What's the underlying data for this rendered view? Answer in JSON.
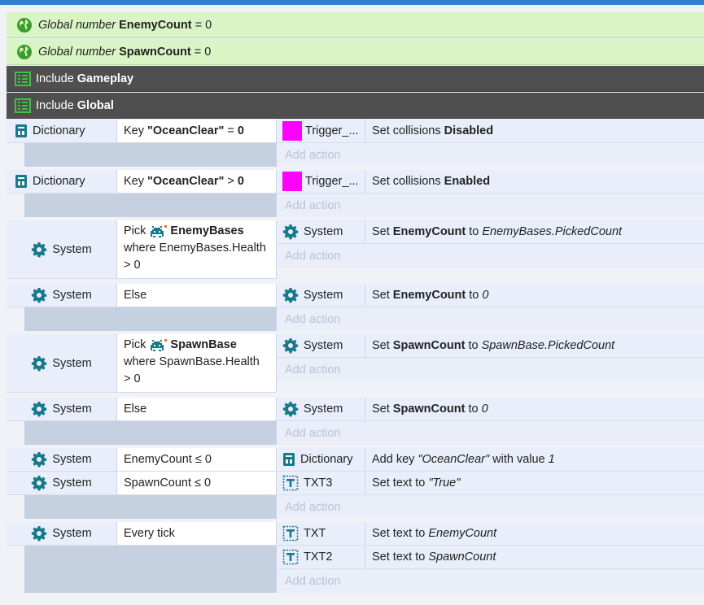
{
  "globals": [
    {
      "prefix": "Global number",
      "name": "EnemyCount",
      "suffix": "= 0"
    },
    {
      "prefix": "Global number",
      "name": "SpawnCount",
      "suffix": "= 0"
    }
  ],
  "includes": [
    {
      "prefix": "Include",
      "name": "Gameplay"
    },
    {
      "prefix": "Include",
      "name": "Global"
    }
  ],
  "add_action_label": "Add action",
  "events": {
    "e1": {
      "cond_obj": "Dictionary",
      "cond_a": "Key",
      "cond_b": "\"OceanClear\"",
      "cond_c": "=",
      "cond_d": "0",
      "act_obj": "Trigger_...",
      "act_a": "Set collisions",
      "act_b": "Disabled"
    },
    "e2": {
      "cond_obj": "Dictionary",
      "cond_a": "Key",
      "cond_b": "\"OceanClear\"",
      "cond_c": ">",
      "cond_d": "0",
      "act_obj": "Trigger_...",
      "act_a": "Set collisions",
      "act_b": "Enabled"
    },
    "e3": {
      "cond_obj": "System",
      "pick": "Pick",
      "family": "EnemyBases",
      "where": "where EnemyBases.Health",
      "where2": "> 0",
      "act_obj": "System",
      "act_a": "Set",
      "act_b": "EnemyCount",
      "act_c": "to",
      "act_d": "EnemyBases.PickedCount"
    },
    "e4": {
      "cond_obj": "System",
      "cond_a": "Else",
      "act_obj": "System",
      "act_a": "Set",
      "act_b": "EnemyCount",
      "act_c": "to",
      "act_d": "0"
    },
    "e5": {
      "cond_obj": "System",
      "pick": "Pick",
      "family": "SpawnBase",
      "where": "where SpawnBase.Health",
      "where2": "> 0",
      "act_obj": "System",
      "act_a": "Set",
      "act_b": "SpawnCount",
      "act_c": "to",
      "act_d": "SpawnBase.PickedCount"
    },
    "e6": {
      "cond_obj": "System",
      "cond_a": "Else",
      "act_obj": "System",
      "act_a": "Set",
      "act_b": "SpawnCount",
      "act_c": "to",
      "act_d": "0"
    },
    "e7": {
      "c1_obj": "System",
      "c1": "EnemyCount ≤ 0",
      "c2_obj": "System",
      "c2": "SpawnCount ≤ 0",
      "a1_obj": "Dictionary",
      "a1_a": "Add key",
      "a1_b": "\"OceanClear\"",
      "a1_c": "with value",
      "a1_d": "1",
      "a2_obj": "TXT3",
      "a2_a": "Set text to",
      "a2_b": "\"True\""
    },
    "e8": {
      "c1_obj": "System",
      "c1": "Every tick",
      "a1_obj": "TXT",
      "a1_a": "Set text to",
      "a1_b": "EnemyCount",
      "a2_obj": "TXT2",
      "a2_a": "Set text to",
      "a2_b": "SpawnCount"
    }
  },
  "colors": {
    "accent": "#2f7fce",
    "global_bg": "#d9f4c5",
    "include_bg": "#4f4f4f",
    "sprite_magenta": "#ff00ff",
    "icon_teal": "#177a8c"
  }
}
